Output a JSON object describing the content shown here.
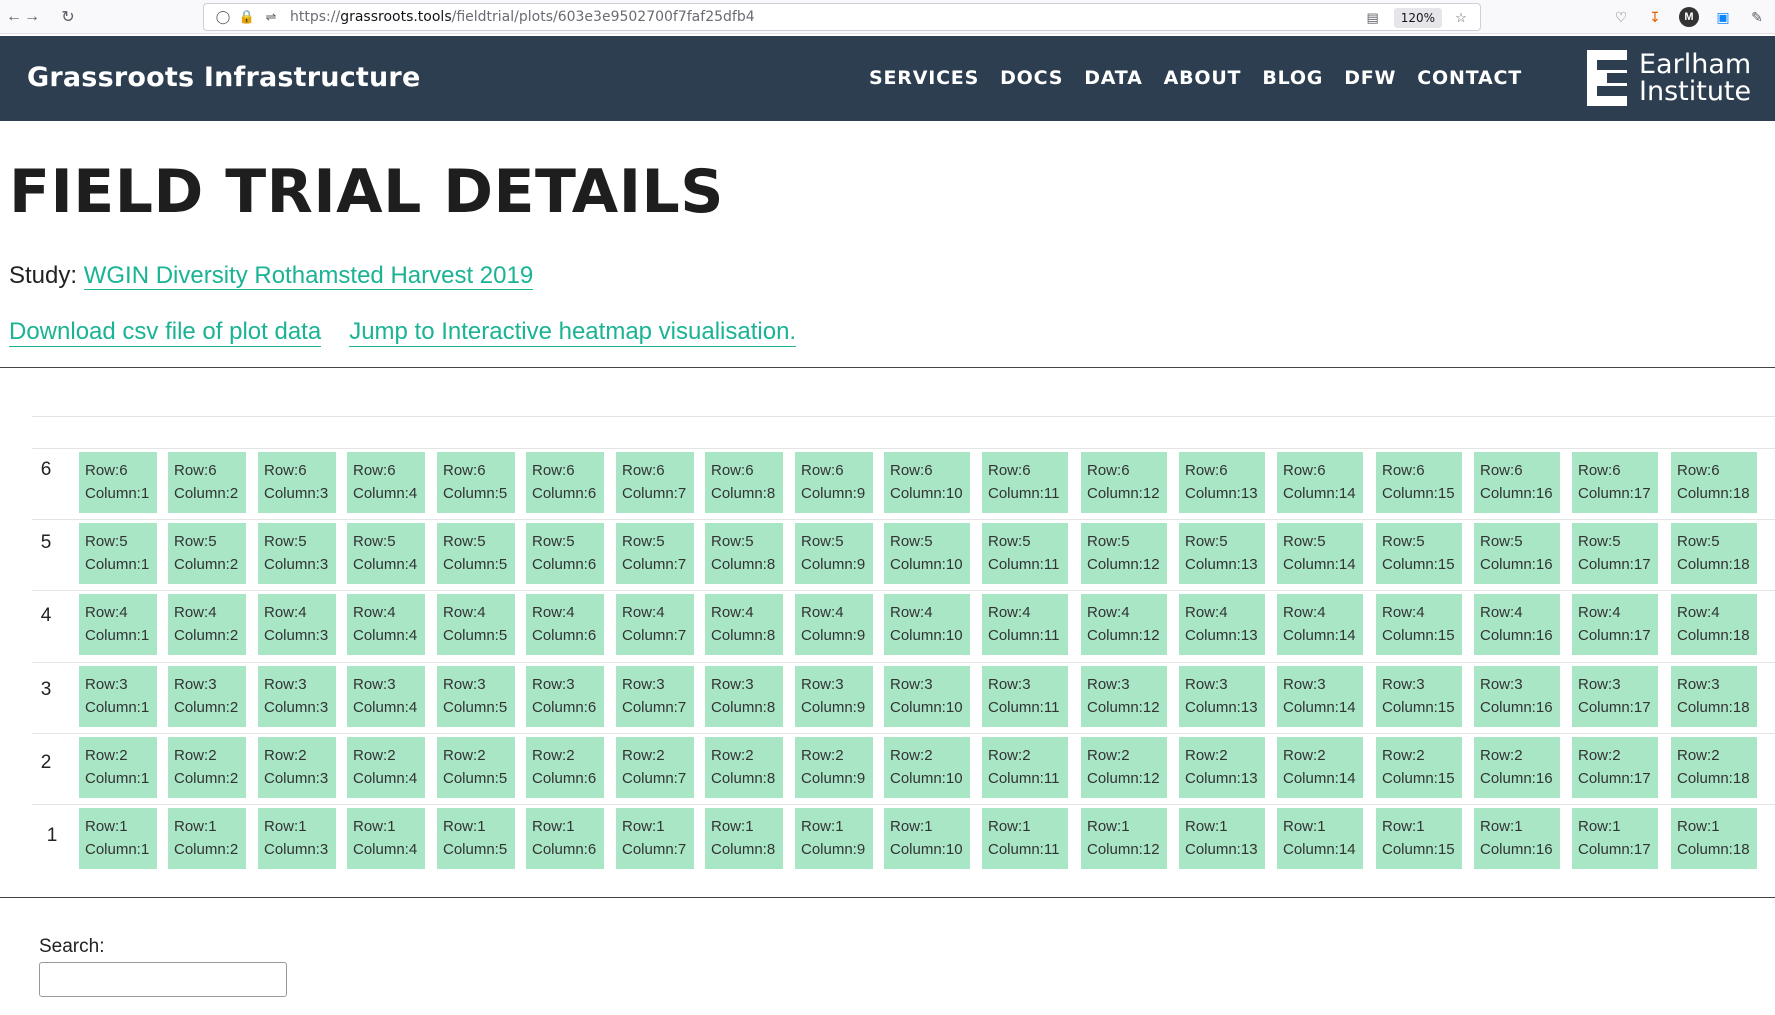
{
  "browser": {
    "url_prefix": "https://",
    "url_host": "grassroots.tools",
    "url_path": "/fieldtrial/plots/603e3e9502700f7faf25dfb4",
    "zoom": "120%"
  },
  "header": {
    "brand": "Grassroots Infrastructure",
    "nav": [
      "SERVICES",
      "DOCS",
      "DATA",
      "ABOUT",
      "BLOG",
      "DFW",
      "CONTACT"
    ],
    "logo_line1": "Earlham",
    "logo_line2": "Institute"
  },
  "main": {
    "title": "FIELD TRIAL DETAILS",
    "study_label": "Study:",
    "study_link": "WGIN Diversity Rothamsted Harvest 2019",
    "download_link": "Download csv file of plot data",
    "heatmap_link": "Jump to Interactive heatmap visualisation."
  },
  "grid": {
    "rows": [
      6,
      5,
      4,
      3,
      2,
      1
    ],
    "columns": [
      1,
      2,
      3,
      4,
      5,
      6,
      7,
      8,
      9,
      10,
      11,
      12,
      13,
      14,
      15,
      16,
      17,
      18
    ],
    "row_prefix": "Row:",
    "column_prefix": "Column:",
    "cell_color": "#a8e6c6"
  },
  "search": {
    "label": "Search:",
    "value": "",
    "placeholder": ""
  },
  "colors": {
    "header_bg": "#2c3e50",
    "link": "#1ab394"
  }
}
